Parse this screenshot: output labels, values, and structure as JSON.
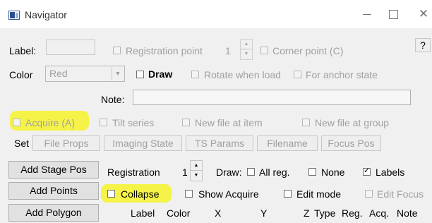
{
  "window": {
    "title": "Navigator",
    "icon": "navigator-app-icon",
    "controls": [
      "minimize-icon",
      "maximize-icon",
      "close-icon"
    ]
  },
  "row1": {
    "label_text": "Label:",
    "label_value": "",
    "registration_point_label": "Registration point",
    "registration_point_value": "1",
    "corner_point_label": "Corner point (C)",
    "help_label": "?"
  },
  "row2": {
    "color_label": "Color",
    "color_value": "Red",
    "draw_label": "Draw",
    "rotate_label": "Rotate when load",
    "anchor_label": "For anchor state"
  },
  "note": {
    "label": "Note:",
    "value": ""
  },
  "row4": {
    "acquire_label": "Acquire (A)",
    "tilt_label": "Tilt series",
    "newfile_item_label": "New file at item",
    "newfile_group_label": "New file at group"
  },
  "setrow": {
    "set_label": "Set",
    "buttons": [
      "File Props",
      "Imaging State",
      "TS Params",
      "Filename",
      "Focus Pos"
    ]
  },
  "left_buttons": {
    "add_stage_pos": "Add Stage Pos",
    "add_points": "Add Points",
    "add_polygon": "Add Polygon"
  },
  "registration": {
    "label": "Registration",
    "value": "1",
    "draw_label": "Draw:",
    "all_reg_label": "All reg.",
    "none_label": "None",
    "labels_label": "Labels",
    "labels_checked": true
  },
  "options": {
    "collapse_label": "Collapse",
    "show_acquire_label": "Show Acquire",
    "edit_mode_label": "Edit mode",
    "edit_focus_label": "Edit Focus"
  },
  "columns": [
    "Label",
    "Color",
    "X",
    "Y",
    "Z",
    "Type",
    "Reg.",
    "Acq.",
    "Note"
  ],
  "colors": {
    "highlight": "#f5f33a",
    "disabled_text": "#a0a0a0",
    "client_bg": "#f0f0f0"
  }
}
